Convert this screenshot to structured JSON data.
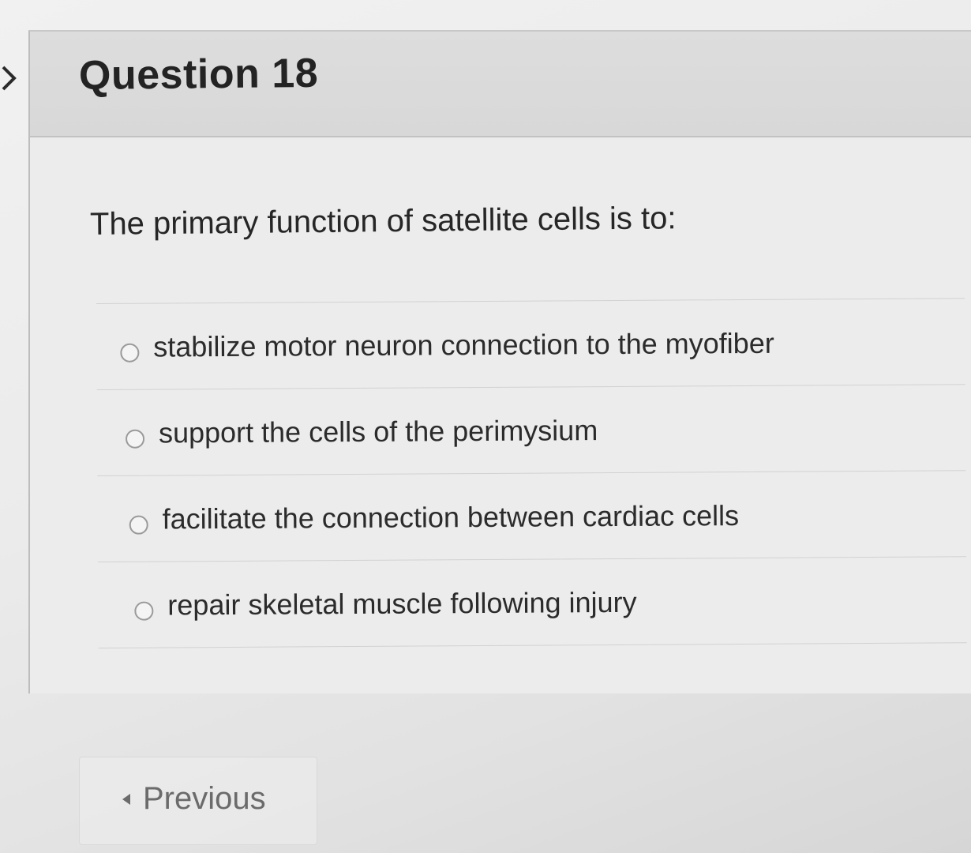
{
  "question": {
    "title": "Question 18",
    "prompt": "The primary function of satellite cells is to:",
    "options": [
      {
        "label": "stabilize motor neuron connection to the myofiber",
        "selected": false
      },
      {
        "label": "support the cells of the perimysium",
        "selected": false
      },
      {
        "label": "facilitate the connection between cardiac cells",
        "selected": false
      },
      {
        "label": "repair skeletal muscle following injury",
        "selected": false
      }
    ]
  },
  "navigation": {
    "previous_label": "Previous",
    "previous_icon": "caret-left-icon"
  },
  "sidebar": {
    "toggle_icon": "chevron-right-icon"
  },
  "colors": {
    "header_background": "#d8d8d8",
    "card_background": "#ececec",
    "text": "#2b2b2b",
    "radio_border": "#9a9a9a"
  }
}
